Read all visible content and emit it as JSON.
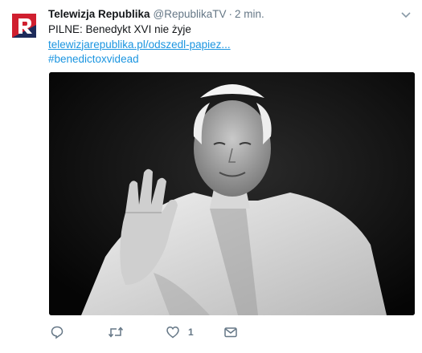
{
  "tweet": {
    "author_name": "Telewizja Republika",
    "author_handle": "@RepublikaTV",
    "separator": "·",
    "time": "2 min.",
    "text_line1": "PILNE: Benedykt XVI nie żyje",
    "link": "telewizjarepublika.pl/odszedl-papiez...",
    "hashtag": "#benedictoxvidead",
    "media_icon": "photo",
    "actions": {
      "reply_icon": "reply-icon",
      "retweet_icon": "retweet-icon",
      "like_icon": "heart-icon",
      "like_count": "1",
      "dm_icon": "envelope-icon"
    }
  },
  "colors": {
    "link": "#1b95e0",
    "muted": "#657786",
    "logo_red": "#d01f2f",
    "logo_navy": "#1d2b5a"
  }
}
